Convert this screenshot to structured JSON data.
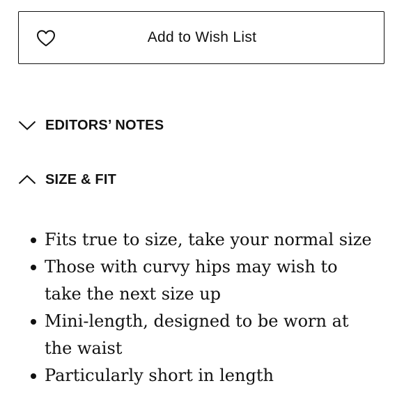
{
  "wishlist": {
    "label": "Add to Wish List",
    "icon": "heart-icon"
  },
  "accordion": {
    "editors_notes": {
      "title": "EDITORS’ NOTES",
      "state": "collapsed",
      "icon": "chevron-down-icon"
    },
    "size_fit": {
      "title": "SIZE & FIT",
      "state": "expanded",
      "icon": "chevron-up-icon",
      "items": [
        "Fits true to size, take your normal size",
        "Those with curvy hips may wish to take the next size up",
        "Mini-length, designed to be worn at the waist",
        "Particularly short in length"
      ]
    }
  },
  "colors": {
    "text": "#111111",
    "background": "#ffffff",
    "border": "#111111"
  }
}
